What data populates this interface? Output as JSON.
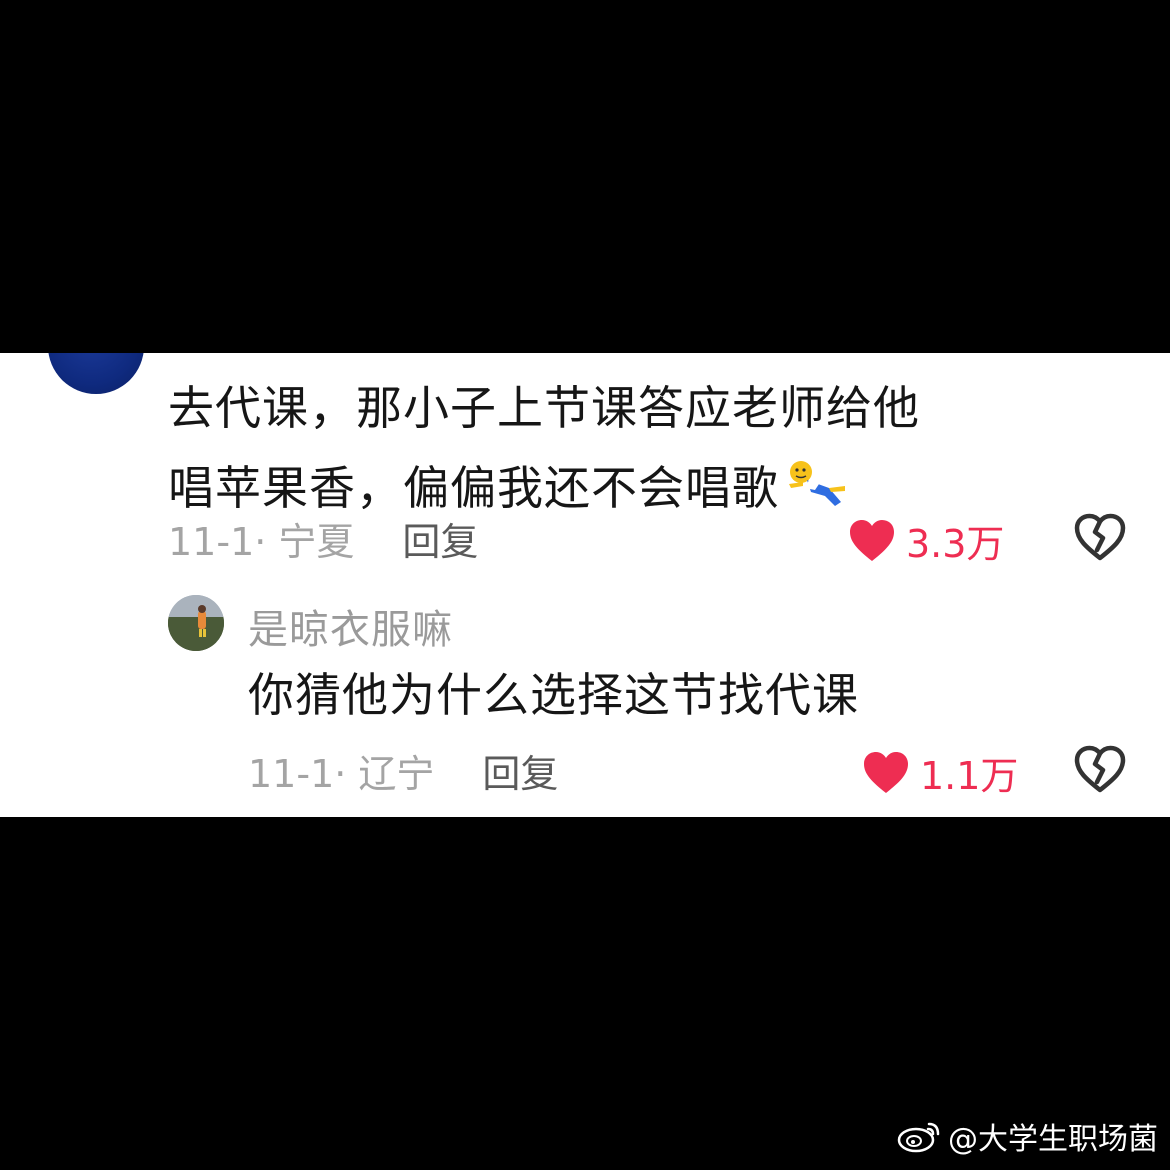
{
  "comment": {
    "text_line1": "去代课，那小子上节课答应老师给他",
    "text_line2": "唱苹果香，偏偏我还不会唱歌",
    "emoji": "falling-person-emoji",
    "meta": "11-1· 宁夏",
    "reply_label": "回复",
    "likes": "3.3万"
  },
  "reply": {
    "username": "是晾衣服嘛",
    "text": "你猜他为什么选择这节找代课",
    "meta": "11-1· 辽宁",
    "reply_label": "回复",
    "likes": "1.1万"
  },
  "watermark": {
    "text": "@大学生职场菌",
    "icon": "weibo-icon"
  },
  "colors": {
    "like_red": "#ee2d52",
    "meta_gray": "#a4a4a4",
    "reply_gray": "#5a5a5a",
    "text_dark": "#161616",
    "background_bar": "#000000",
    "panel": "#ffffff"
  }
}
